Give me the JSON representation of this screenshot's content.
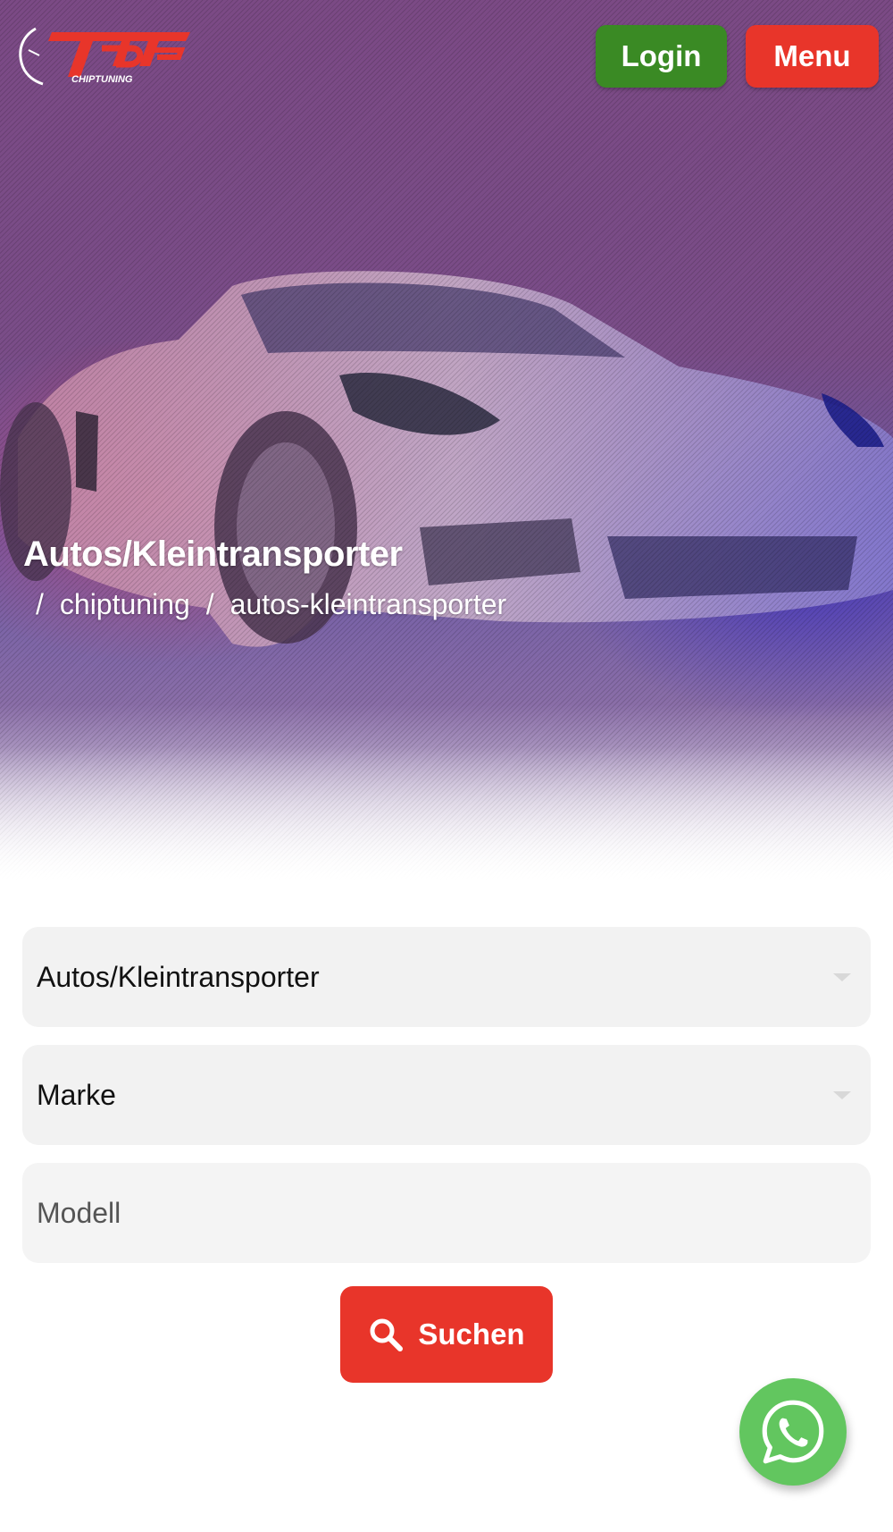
{
  "header": {
    "logo_text": "TDF",
    "logo_subtext": "CHIPTUNING",
    "login_label": "Login",
    "menu_label": "Menu"
  },
  "hero": {
    "title": "Autos/Kleintransporter",
    "breadcrumb": {
      "separator": "/",
      "items": [
        "chiptuning",
        "autos-kleintransporter"
      ]
    }
  },
  "search_form": {
    "category_select": {
      "value": "Autos/Kleintransporter"
    },
    "brand_select": {
      "value": "Marke"
    },
    "model_input": {
      "placeholder": "Modell",
      "value": ""
    },
    "submit_label": "Suchen"
  },
  "floating": {
    "whatsapp_icon": "whatsapp-icon"
  },
  "colors": {
    "login_green": "#3a8a24",
    "accent_red": "#e8352a",
    "whatsapp_green": "#62c65f",
    "field_bg": "#f2f2f2"
  }
}
